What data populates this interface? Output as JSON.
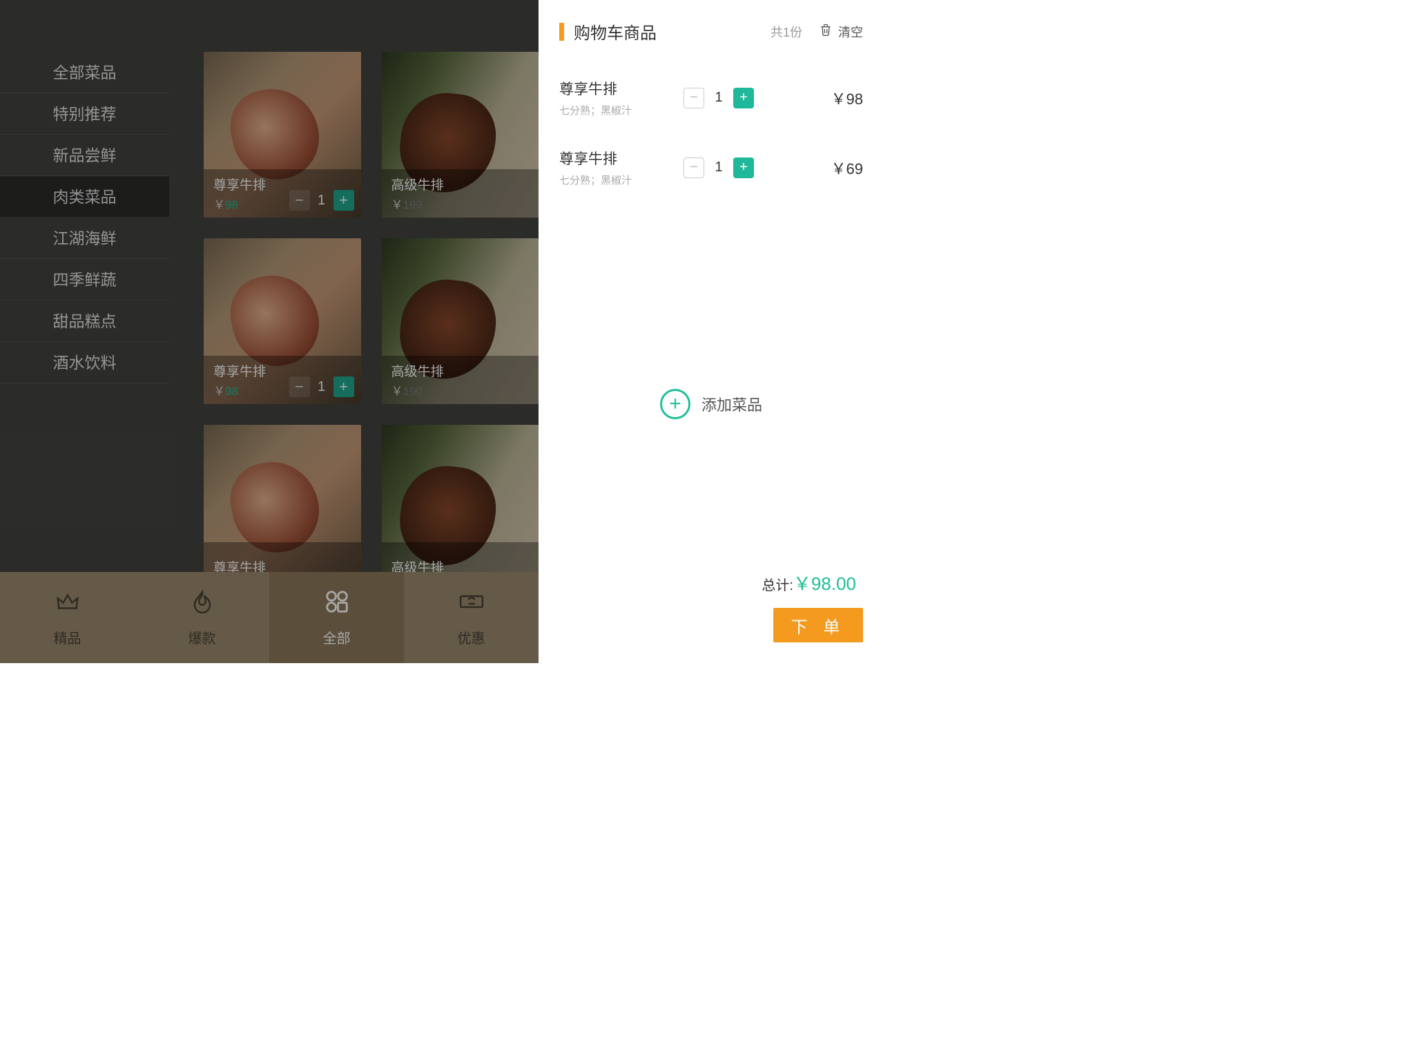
{
  "sidebar": {
    "items": [
      {
        "label": "全部菜品"
      },
      {
        "label": "特别推荐"
      },
      {
        "label": "新品尝鲜"
      },
      {
        "label": "肉类菜品"
      },
      {
        "label": "江湖海鲜"
      },
      {
        "label": "四季鲜蔬"
      },
      {
        "label": "甜品糕点"
      },
      {
        "label": "酒水饮料"
      }
    ],
    "active_index": 3
  },
  "dishes": [
    {
      "name": "尊享牛排",
      "currency": "￥",
      "price": "98",
      "qty": "1",
      "show_qty": true,
      "alt": false
    },
    {
      "name": "高级牛排",
      "currency": "￥",
      "price": "199",
      "qty": "",
      "show_qty": false,
      "alt": true
    },
    {
      "name": "尊享牛排",
      "currency": "￥",
      "price": "98",
      "qty": "1",
      "show_qty": true,
      "alt": false
    },
    {
      "name": "高级牛排",
      "currency": "￥",
      "price": "190",
      "qty": "",
      "show_qty": false,
      "alt": true
    },
    {
      "name": "尊享牛排",
      "currency": "￥",
      "price": "",
      "qty": "",
      "show_qty": false,
      "alt": false
    },
    {
      "name": "高级牛排",
      "currency": "￥",
      "price": "",
      "qty": "",
      "show_qty": false,
      "alt": true
    }
  ],
  "bottombar": {
    "items": [
      {
        "label": "精品",
        "icon": "crown"
      },
      {
        "label": "爆款",
        "icon": "flame"
      },
      {
        "label": "全部",
        "icon": "grid"
      },
      {
        "label": "优惠",
        "icon": "ticket"
      }
    ],
    "active_index": 2
  },
  "cart": {
    "title": "购物车商品",
    "count_label": "共1份",
    "clear_label": "清空",
    "items": [
      {
        "name": "尊享牛排",
        "options": "七分熟；黑椒汁",
        "qty": "1",
        "price": "￥98"
      },
      {
        "name": "尊享牛排",
        "options": "七分熟；黑椒汁",
        "qty": "1",
        "price": "￥69"
      }
    ],
    "add_label": "添加菜品",
    "total_label": "总计:",
    "total_amount": "￥98.00",
    "order_label": "下 单"
  }
}
